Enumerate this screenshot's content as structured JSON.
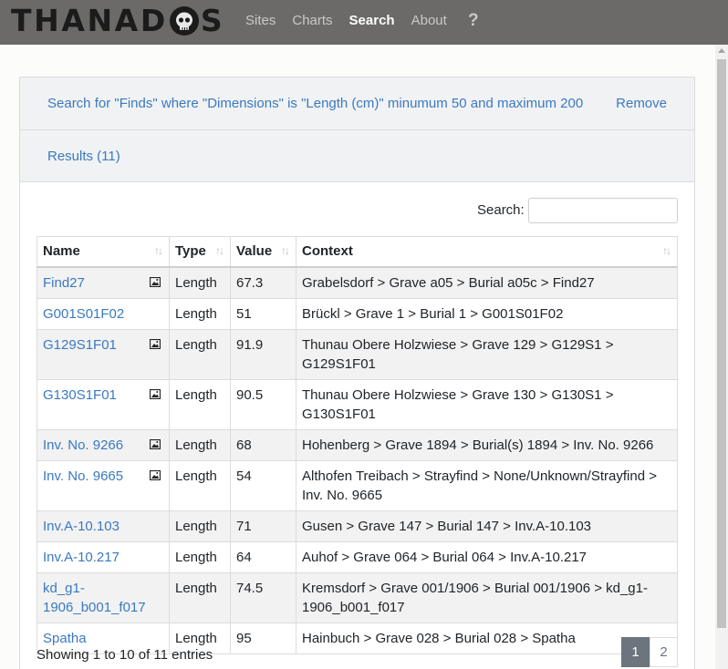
{
  "brand": {
    "text_left": "THANAD",
    "text_right": "S"
  },
  "nav": {
    "items": [
      "Sites",
      "Charts",
      "Search",
      "About"
    ],
    "active": "Search",
    "help": "?"
  },
  "query": {
    "text": "Search for \"Finds\" where \"Dimensions\" is \"Length (cm)\" minumum 50 and maximum 200",
    "remove_label": "Remove"
  },
  "results": {
    "label": "Results (11)"
  },
  "search": {
    "label": "Search:",
    "value": ""
  },
  "table": {
    "headers": [
      "Name",
      "Type",
      "Value",
      "Context"
    ],
    "rows": [
      {
        "name": "Find27",
        "type": "Length",
        "value": "67.3",
        "context": "Grabelsdorf > Grave a05 > Burial a05c > Find27",
        "has_image": true
      },
      {
        "name": "G001S01F02",
        "type": "Length",
        "value": "51",
        "context": "Brückl > Grave 1 > Burial 1 > G001S01F02",
        "has_image": false
      },
      {
        "name": "G129S1F01",
        "type": "Length",
        "value": "91.9",
        "context": "Thunau Obere Holzwiese > Grave 129 > G129S1 > G129S1F01",
        "has_image": true
      },
      {
        "name": "G130S1F01",
        "type": "Length",
        "value": "90.5",
        "context": "Thunau Obere Holzwiese > Grave 130 > G130S1 > G130S1F01",
        "has_image": true
      },
      {
        "name": "Inv. No. 9266",
        "type": "Length",
        "value": "68",
        "context": "Hohenberg > Grave 1894 > Burial(s) 1894 > Inv. No. 9266",
        "has_image": true
      },
      {
        "name": "Inv. No. 9665",
        "type": "Length",
        "value": "54",
        "context": "Althofen Treibach > Strayfind > None/Unknown/Strayfind > Inv. No. 9665",
        "has_image": true
      },
      {
        "name": "Inv.A-10.103",
        "type": "Length",
        "value": "71",
        "context": "Gusen > Grave 147 > Burial 147 > Inv.A-10.103",
        "has_image": false
      },
      {
        "name": "Inv.A-10.217",
        "type": "Length",
        "value": "64",
        "context": "Auhof > Grave 064 > Burial 064 > Inv.A-10.217",
        "has_image": false
      },
      {
        "name": "kd_g1-1906_b001_f017",
        "type": "Length",
        "value": "74.5",
        "context": "Kremsdorf > Grave 001/1906 > Burial 001/1906 > kd_g1-1906_b001_f017",
        "has_image": false
      },
      {
        "name": "Spatha",
        "type": "Length",
        "value": "95",
        "context": "Hainbuch > Grave 028 > Burial 028 > Spatha",
        "has_image": false
      }
    ]
  },
  "footer": {
    "info": "Showing 1 to 10 of 11 entries",
    "pages": [
      "1",
      "2"
    ],
    "active_page": "1"
  },
  "colors": {
    "navbar": "#6b6a68",
    "link": "#3a79c2",
    "active_page": "#6c757d"
  }
}
